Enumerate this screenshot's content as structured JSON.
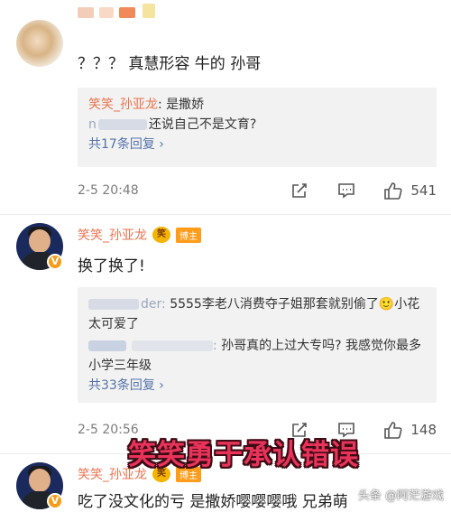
{
  "comments": [
    {
      "text": "？？？ 真慧形容 牛的 孙哥",
      "replies": [
        {
          "name": "笑笑_孙亚龙",
          "sep": ": ",
          "text": "是撒娇"
        },
        {
          "prefix": "n",
          "text": "还说自己不是文育?"
        }
      ],
      "more": "共17条回复",
      "time": "2-5 20:48",
      "likes": "541"
    },
    {
      "username": "笑笑_孙亚龙",
      "badge": "博主",
      "text": "换了换了!",
      "replies": [
        {
          "prefix": "der: ",
          "text": "5555李老八消费夺子姐那套就别偷了🙂小花太可爱了"
        },
        {
          "prefix": ": ",
          "text": "孙哥真的上过大专吗? 我感觉你最多小学三年级"
        }
      ],
      "more": "共33条回复",
      "time": "2-5 20:56",
      "likes": "148"
    },
    {
      "username": "笑笑_孙亚龙",
      "badge": "博主",
      "text": "吃了没文化的亏 是撒娇嘤嘤嘤哦 兄弟萌"
    }
  ],
  "overlay_caption": "笑笑勇于承认错误",
  "watermark": "头条 @阿茫游戏",
  "colors": {
    "username": "#eb7350",
    "link": "#5573a8",
    "caption": "#e8335a",
    "badge": "#ff9c1a"
  }
}
